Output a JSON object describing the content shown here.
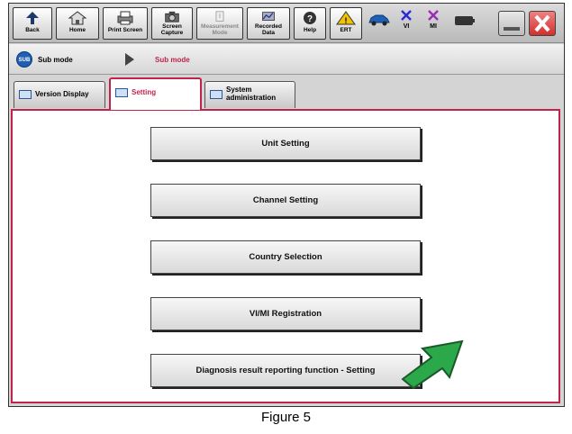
{
  "toolbar": {
    "back_label": "Back",
    "home_label": "Home",
    "print_label": "Print Screen",
    "screen_capture_label_1": "Screen",
    "screen_capture_label_2": "Capture",
    "measurement_label_1": "Measurement",
    "measurement_label_2": "Mode",
    "recorded_label_1": "Recorded",
    "recorded_label_2": "Data",
    "help_label": "Help",
    "ert_label": "ERT",
    "vi_label": "VI",
    "mi_label": "MI"
  },
  "modebar": {
    "badge": "SUB",
    "current": "Sub mode",
    "next": "Sub mode"
  },
  "tabs": [
    {
      "label": "Version Display"
    },
    {
      "label": "Setting"
    },
    {
      "label_1": "System",
      "label_2": "administration"
    }
  ],
  "menu": [
    {
      "label": "Unit Setting"
    },
    {
      "label": "Channel Setting"
    },
    {
      "label": "Country Selection"
    },
    {
      "label": "VI/MI Registration"
    },
    {
      "label": "Diagnosis result reporting function - Setting"
    }
  ],
  "caption": "Figure 5",
  "colors": {
    "accent": "#c2234a",
    "arrow": "#2aa84a",
    "mark": "#2b2bd6",
    "mark_mi": "#9b2bb3",
    "close": "#e24a4a"
  }
}
